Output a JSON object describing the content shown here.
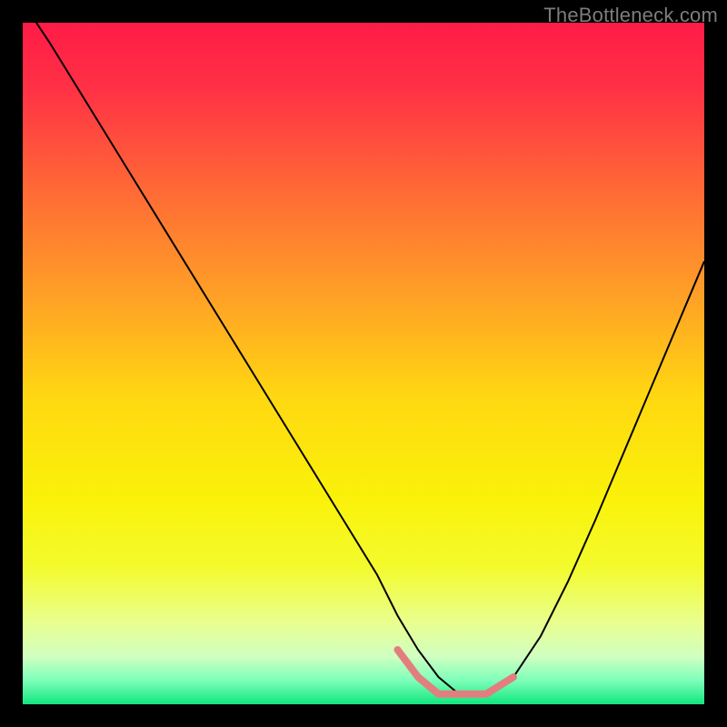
{
  "watermark": "TheBottleneck.com",
  "chart_data": {
    "type": "line",
    "title": "",
    "xlabel": "",
    "ylabel": "",
    "xlim": [
      0,
      100
    ],
    "ylim": [
      0,
      100
    ],
    "background_gradient": {
      "type": "vertical",
      "stops": [
        {
          "offset": 0.0,
          "color": "#ff1b47"
        },
        {
          "offset": 0.1,
          "color": "#ff3245"
        },
        {
          "offset": 0.25,
          "color": "#ff6b35"
        },
        {
          "offset": 0.4,
          "color": "#ffa026"
        },
        {
          "offset": 0.55,
          "color": "#ffd811"
        },
        {
          "offset": 0.7,
          "color": "#faf20a"
        },
        {
          "offset": 0.8,
          "color": "#f3fb2e"
        },
        {
          "offset": 0.88,
          "color": "#e9ff8f"
        },
        {
          "offset": 0.93,
          "color": "#d0ffc1"
        },
        {
          "offset": 0.965,
          "color": "#7dffba"
        },
        {
          "offset": 1.0,
          "color": "#12e67e"
        }
      ]
    },
    "curve": {
      "name": "bottleneck-curve",
      "color": "#000000",
      "stroke_width": 2,
      "x": [
        0,
        4,
        8,
        12,
        16,
        20,
        24,
        28,
        32,
        36,
        40,
        44,
        48,
        52,
        55,
        58,
        61,
        64,
        68,
        72,
        76,
        80,
        84,
        88,
        92,
        96,
        100
      ],
      "y": [
        103,
        97,
        90.5,
        84,
        77.5,
        71,
        64.5,
        58,
        51.5,
        45,
        38.5,
        32,
        25.5,
        19,
        13,
        8,
        4,
        1.5,
        1.5,
        4,
        10,
        18,
        27,
        36.5,
        46,
        55.5,
        65
      ]
    },
    "basin_marker": {
      "name": "optimal-basin",
      "color": "#e27e7e",
      "stroke_width": 8,
      "x": [
        55,
        58,
        61,
        64,
        68,
        72
      ],
      "y": [
        8,
        4,
        1.5,
        1.5,
        1.5,
        4
      ]
    }
  }
}
